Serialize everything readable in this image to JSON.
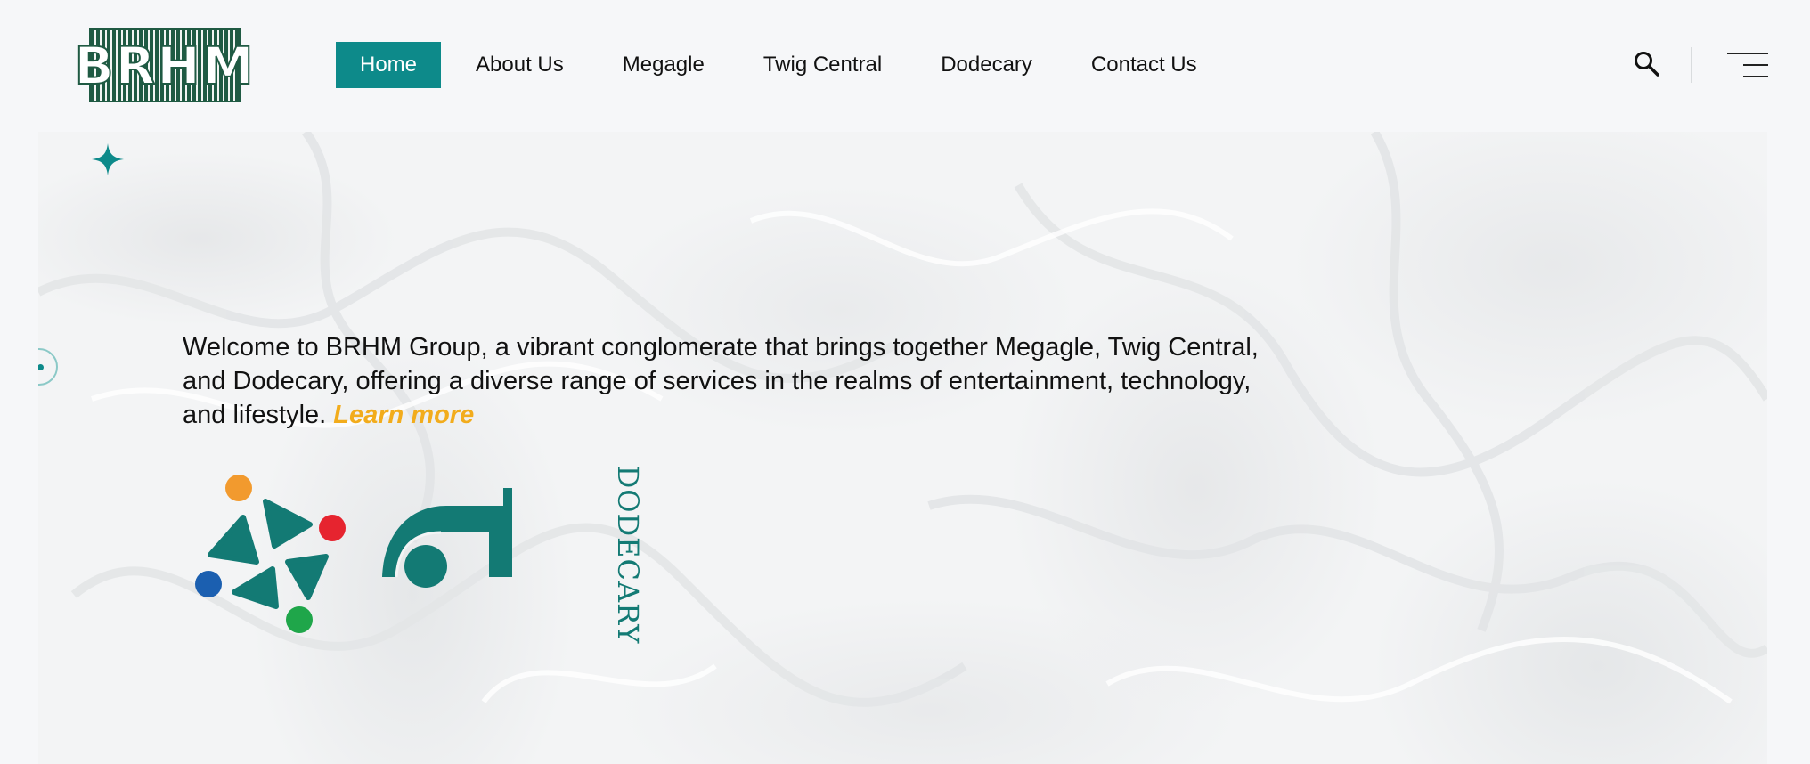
{
  "header": {
    "logo_text": "BRHM",
    "nav": [
      {
        "label": "Home",
        "active": true
      },
      {
        "label": "About Us",
        "active": false
      },
      {
        "label": "Megagle",
        "active": false
      },
      {
        "label": "Twig Central",
        "active": false
      },
      {
        "label": "Dodecary",
        "active": false
      },
      {
        "label": "Contact Us",
        "active": false
      }
    ],
    "icons": {
      "search": "search-icon",
      "menu": "hamburger-menu-icon"
    }
  },
  "hero": {
    "intro_text": "Welcome to BRHM Group, a vibrant conglomerate that brings together Megagle, Twig Central, and Dodecary, offering a diverse range of services in the realms of entertainment, technology, and lifestyle. ",
    "learn_more": "Learn more",
    "brands": {
      "megagle_icon": "megagle-logo-icon",
      "twig_icon": "twig-central-logo-icon",
      "dodecary_text": "DODECARY"
    }
  },
  "colors": {
    "accent": "#0d8a8a",
    "learn_more": "#f2ac1c",
    "brand_green": "#1f5a43",
    "text": "#111111"
  }
}
